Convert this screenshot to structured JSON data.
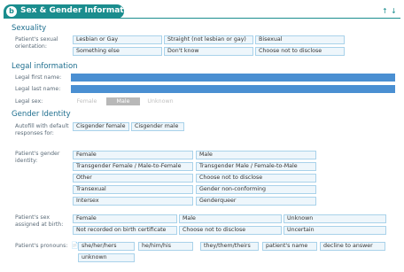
{
  "header": {
    "title": "Sex & Gender Information",
    "logo_letter": "b",
    "icon_up": "↑",
    "icon_down": "↓"
  },
  "sexuality": {
    "title": "Sexuality",
    "label": "Patient's sexual orientation:",
    "options": [
      "Lesbian or Gay",
      "Straight (not lesbian or gay)",
      "Bisexual",
      "Something else",
      "Don't know",
      "Choose not to disclose"
    ]
  },
  "legal": {
    "title": "Legal information",
    "first_name_label": "Legal first name:",
    "last_name_label": "Legal last name:",
    "sex_label": "Legal sex:",
    "sex_options": [
      "Female",
      "Male",
      "Unknown"
    ],
    "selected_sex": "Male"
  },
  "gender": {
    "title": "Gender Identity",
    "autofill_label": "Autofill with default responses for:",
    "autofill_options": [
      "Cisgender female",
      "Cisgender male"
    ],
    "identity_label": "Patient's gender identity:",
    "identity_options": [
      "Female",
      "Male",
      "Transgender Female / Male-to-Female",
      "Transgender Male / Female-to-Male",
      "Other",
      "Choose not to disclose",
      "Transexual",
      "Gender non-conforming",
      "Intersex",
      "Genderqueer"
    ],
    "birth_label": "Patient's sex assigned at birth:",
    "birth_options": [
      "Female",
      "Male",
      "Unknown",
      "Not recorded on birth certificate",
      "Choose not to disclose",
      "Uncertain"
    ],
    "pronouns_label": "Patient's pronouns:",
    "pronoun_options": [
      "she/her/hers",
      "he/him/his",
      "they/them/theirs",
      "patient's name",
      "decline to answer",
      "unknown"
    ]
  }
}
